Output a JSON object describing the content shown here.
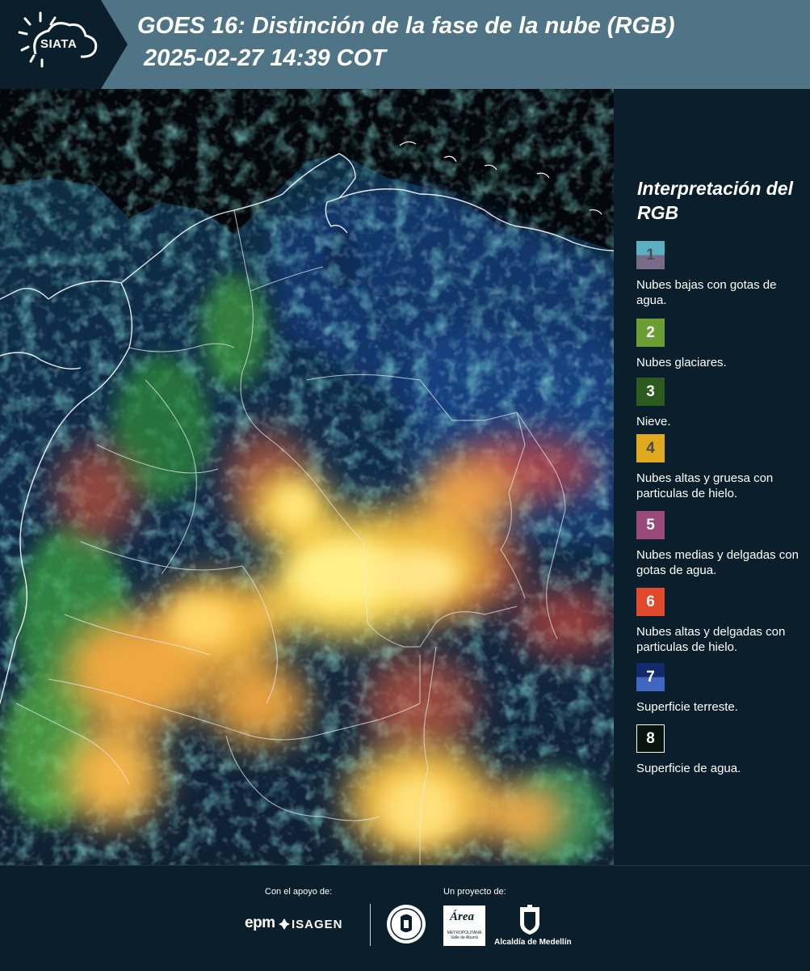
{
  "header": {
    "logo_text": "SIATA",
    "title_line1": "GOES 16: Distinción de la fase de la nube (RGB)",
    "title_line2": "2025-02-27 14:39 COT"
  },
  "legend": {
    "title": "Interpretación del RGB",
    "items": [
      {
        "number": "1",
        "label": "Nubes bajas con gotas de agua.",
        "color_top": "#5ab0c0",
        "color_bottom": "#7a6a8a",
        "number_color": "#4a4a5a"
      },
      {
        "number": "2",
        "label": "Nubes glaciares.",
        "color_top": "#6b9e32",
        "color_bottom": "#6b9e32",
        "number_color": "#ffffff"
      },
      {
        "number": "3",
        "label": "Nieve.",
        "color_top": "#2d5a1f",
        "color_bottom": "#2d5a1f",
        "number_color": "#ffffff"
      },
      {
        "number": "4",
        "label": "Nubes altas y gruesa con particulas de hielo.",
        "color_top": "#e0a91e",
        "color_bottom": "#e0a91e",
        "number_color": "#4a4a4a"
      },
      {
        "number": "5",
        "label": "Nubes medias y delgadas con gotas de agua.",
        "color_top": "#9a4a7a",
        "color_bottom": "#9a4a7a",
        "number_color": "#ffffff"
      },
      {
        "number": "6",
        "label": "Nubes altas y delgadas con particulas de hielo.",
        "color_top": "#e04a2a",
        "color_bottom": "#e04a2a",
        "number_color": "#ffffff"
      },
      {
        "number": "7",
        "label": "Superficie terreste.",
        "color_top": "#12296a",
        "color_bottom": "#3f66c0",
        "number_color": "#ffffff"
      },
      {
        "number": "8",
        "label": "Superficie de agua.",
        "color_top": "#08150e",
        "color_bottom": "#08150e",
        "number_color": "#ffffff"
      }
    ]
  },
  "footer": {
    "support_label": "Con el apoyo de:",
    "project_label": "Un proyecto de:",
    "epm_text": "epm",
    "isagen_text": "ISAGEN",
    "area_word": "Área",
    "area_sub": "METROPOLITANA Valle de Aburrá",
    "alcaldia_text": "Alcaldía de Medellín"
  }
}
